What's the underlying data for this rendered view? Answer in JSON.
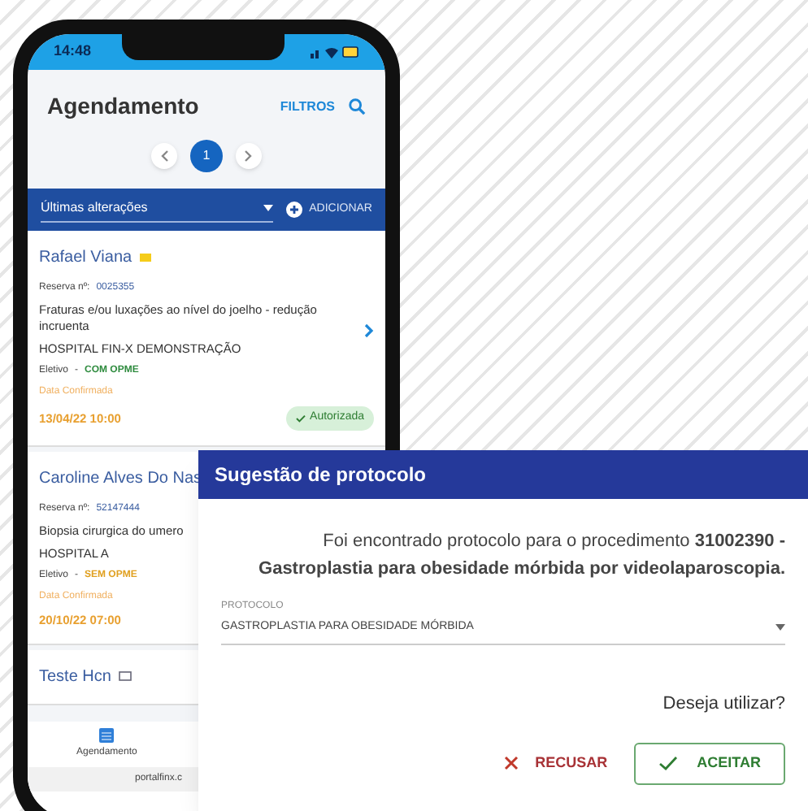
{
  "status_bar": {
    "time": "14:48"
  },
  "header": {
    "title": "Agendamento",
    "filters": "FILTROS"
  },
  "pager": [
    {
      "label": "1",
      "selected": true
    }
  ],
  "toolbar": {
    "select": "Últimas alterações",
    "add": "ADICIONAR"
  },
  "cards": [
    {
      "kind": "flagged",
      "name": "Rafael Viana",
      "reserva_label": "Reserva nº:",
      "reserva": "0025355",
      "procedure": "Fraturas e/ou luxações ao nível do joelho - redução incruenta",
      "hospital": "HOSPITAL FIN-X DEMONSTRAÇÃO",
      "type": "Eletivo",
      "sep": "-",
      "opme": "COM OPME",
      "color": "#2e8b3e",
      "date_label": "Data Confirmada",
      "date": "13/04/22 10:00",
      "status": "Autorizada"
    },
    {
      "kind": "plain",
      "name": "Caroline Alves Do Nas",
      "reserva_label": "Reserva nº:",
      "reserva": "52147444",
      "procedure": "Biopsia cirurgica do umero",
      "hospital": "HOSPITAL A",
      "type": "Eletivo",
      "sep": "-",
      "opme": "SEM OPME",
      "color": "#e0a020",
      "date_label": "Data Confirmada",
      "date": "20/10/22 07:00"
    },
    {
      "kind": "commented",
      "name": "Teste Hcn"
    }
  ],
  "bottom_nav": {
    "label": "Agendamento",
    "url": "portalfinx.c"
  },
  "dialog": {
    "title": "Sugestão de protocolo",
    "message": "Foi encontrado protocolo para o procedimento **31002390 - Gastroplastia para obesidade mórbida por videolaparoscopia.**",
    "field_label": "PROTOCOLO",
    "field_value": "GASTROPLASTIA PARA OBESIDADE MÓRBIDA",
    "question": "Deseja utilizar?",
    "refuse": "RECUSAR",
    "accept": "ACEITAR"
  }
}
